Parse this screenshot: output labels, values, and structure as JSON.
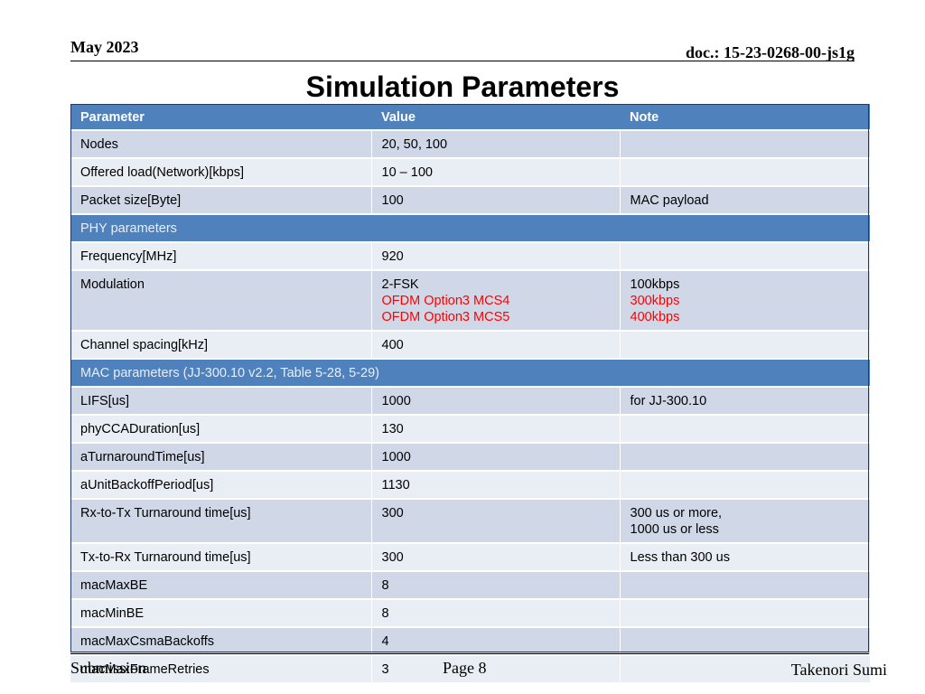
{
  "header": {
    "date": "May 2023",
    "doc": "doc.: 15-23-0268-00-js1g"
  },
  "title": "Simulation Parameters",
  "table": {
    "headers": [
      "Parameter",
      "Value",
      "Note"
    ],
    "rows": [
      {
        "type": "data",
        "cells": [
          [
            "Nodes"
          ],
          [
            "20, 50, 100"
          ],
          []
        ]
      },
      {
        "type": "data",
        "cells": [
          [
            "Offered load(Network)[kbps]"
          ],
          [
            "10 – 100"
          ],
          []
        ]
      },
      {
        "type": "data",
        "cells": [
          [
            "Packet size[Byte]"
          ],
          [
            "100"
          ],
          [
            "MAC payload"
          ]
        ]
      },
      {
        "type": "section",
        "label": "PHY parameters"
      },
      {
        "type": "data",
        "cells": [
          [
            "Frequency[MHz]"
          ],
          [
            "920"
          ],
          []
        ]
      },
      {
        "type": "data",
        "cells": [
          [
            "Modulation"
          ],
          [
            "2-FSK",
            "OFDM Option3 MCS4",
            "OFDM Option3 MCS5"
          ],
          [
            "100kbps",
            "300kbps",
            "400kbps"
          ]
        ],
        "red_lines": [
          1,
          2
        ]
      },
      {
        "type": "data",
        "cells": [
          [
            "Channel spacing[kHz]"
          ],
          [
            "400"
          ],
          []
        ]
      },
      {
        "type": "section",
        "label": "MAC parameters (JJ-300.10 v2.2, Table 5-28, 5-29)"
      },
      {
        "type": "data",
        "cells": [
          [
            "LIFS[us]"
          ],
          [
            "1000"
          ],
          [
            "for JJ-300.10"
          ]
        ]
      },
      {
        "type": "data",
        "cells": [
          [
            "phyCCADuration[us]"
          ],
          [
            "130"
          ],
          []
        ]
      },
      {
        "type": "data",
        "cells": [
          [
            "aTurnaroundTime[us]"
          ],
          [
            "1000"
          ],
          []
        ]
      },
      {
        "type": "data",
        "cells": [
          [
            "aUnitBackoffPeriod[us]"
          ],
          [
            "1130"
          ],
          []
        ]
      },
      {
        "type": "data",
        "cells": [
          [
            "Rx-to-Tx Turnaround time[us]"
          ],
          [
            "300"
          ],
          [
            "300 us or more,",
            "1000 us or less"
          ]
        ]
      },
      {
        "type": "data",
        "cells": [
          [
            "Tx-to-Rx Turnaround time[us]"
          ],
          [
            "300"
          ],
          [
            "Less than 300 us"
          ]
        ]
      },
      {
        "type": "data",
        "cells": [
          [
            "macMaxBE"
          ],
          [
            "8"
          ],
          []
        ]
      },
      {
        "type": "data",
        "cells": [
          [
            "macMinBE"
          ],
          [
            "8"
          ],
          []
        ]
      },
      {
        "type": "data",
        "cells": [
          [
            "macMaxCsmaBackoffs"
          ],
          [
            "4"
          ],
          []
        ]
      },
      {
        "type": "data",
        "cells": [
          [
            "macMaxFrameRetries"
          ],
          [
            "3"
          ],
          []
        ]
      }
    ]
  },
  "footer": {
    "submission": "Submission",
    "page": "Page 8",
    "author": "Takenori Sumi"
  },
  "colors": {
    "header_bg": "#4f81bd",
    "row_odd": "#d0d8e8",
    "row_even": "#e9edf4",
    "highlight_text": "#ff0000"
  }
}
